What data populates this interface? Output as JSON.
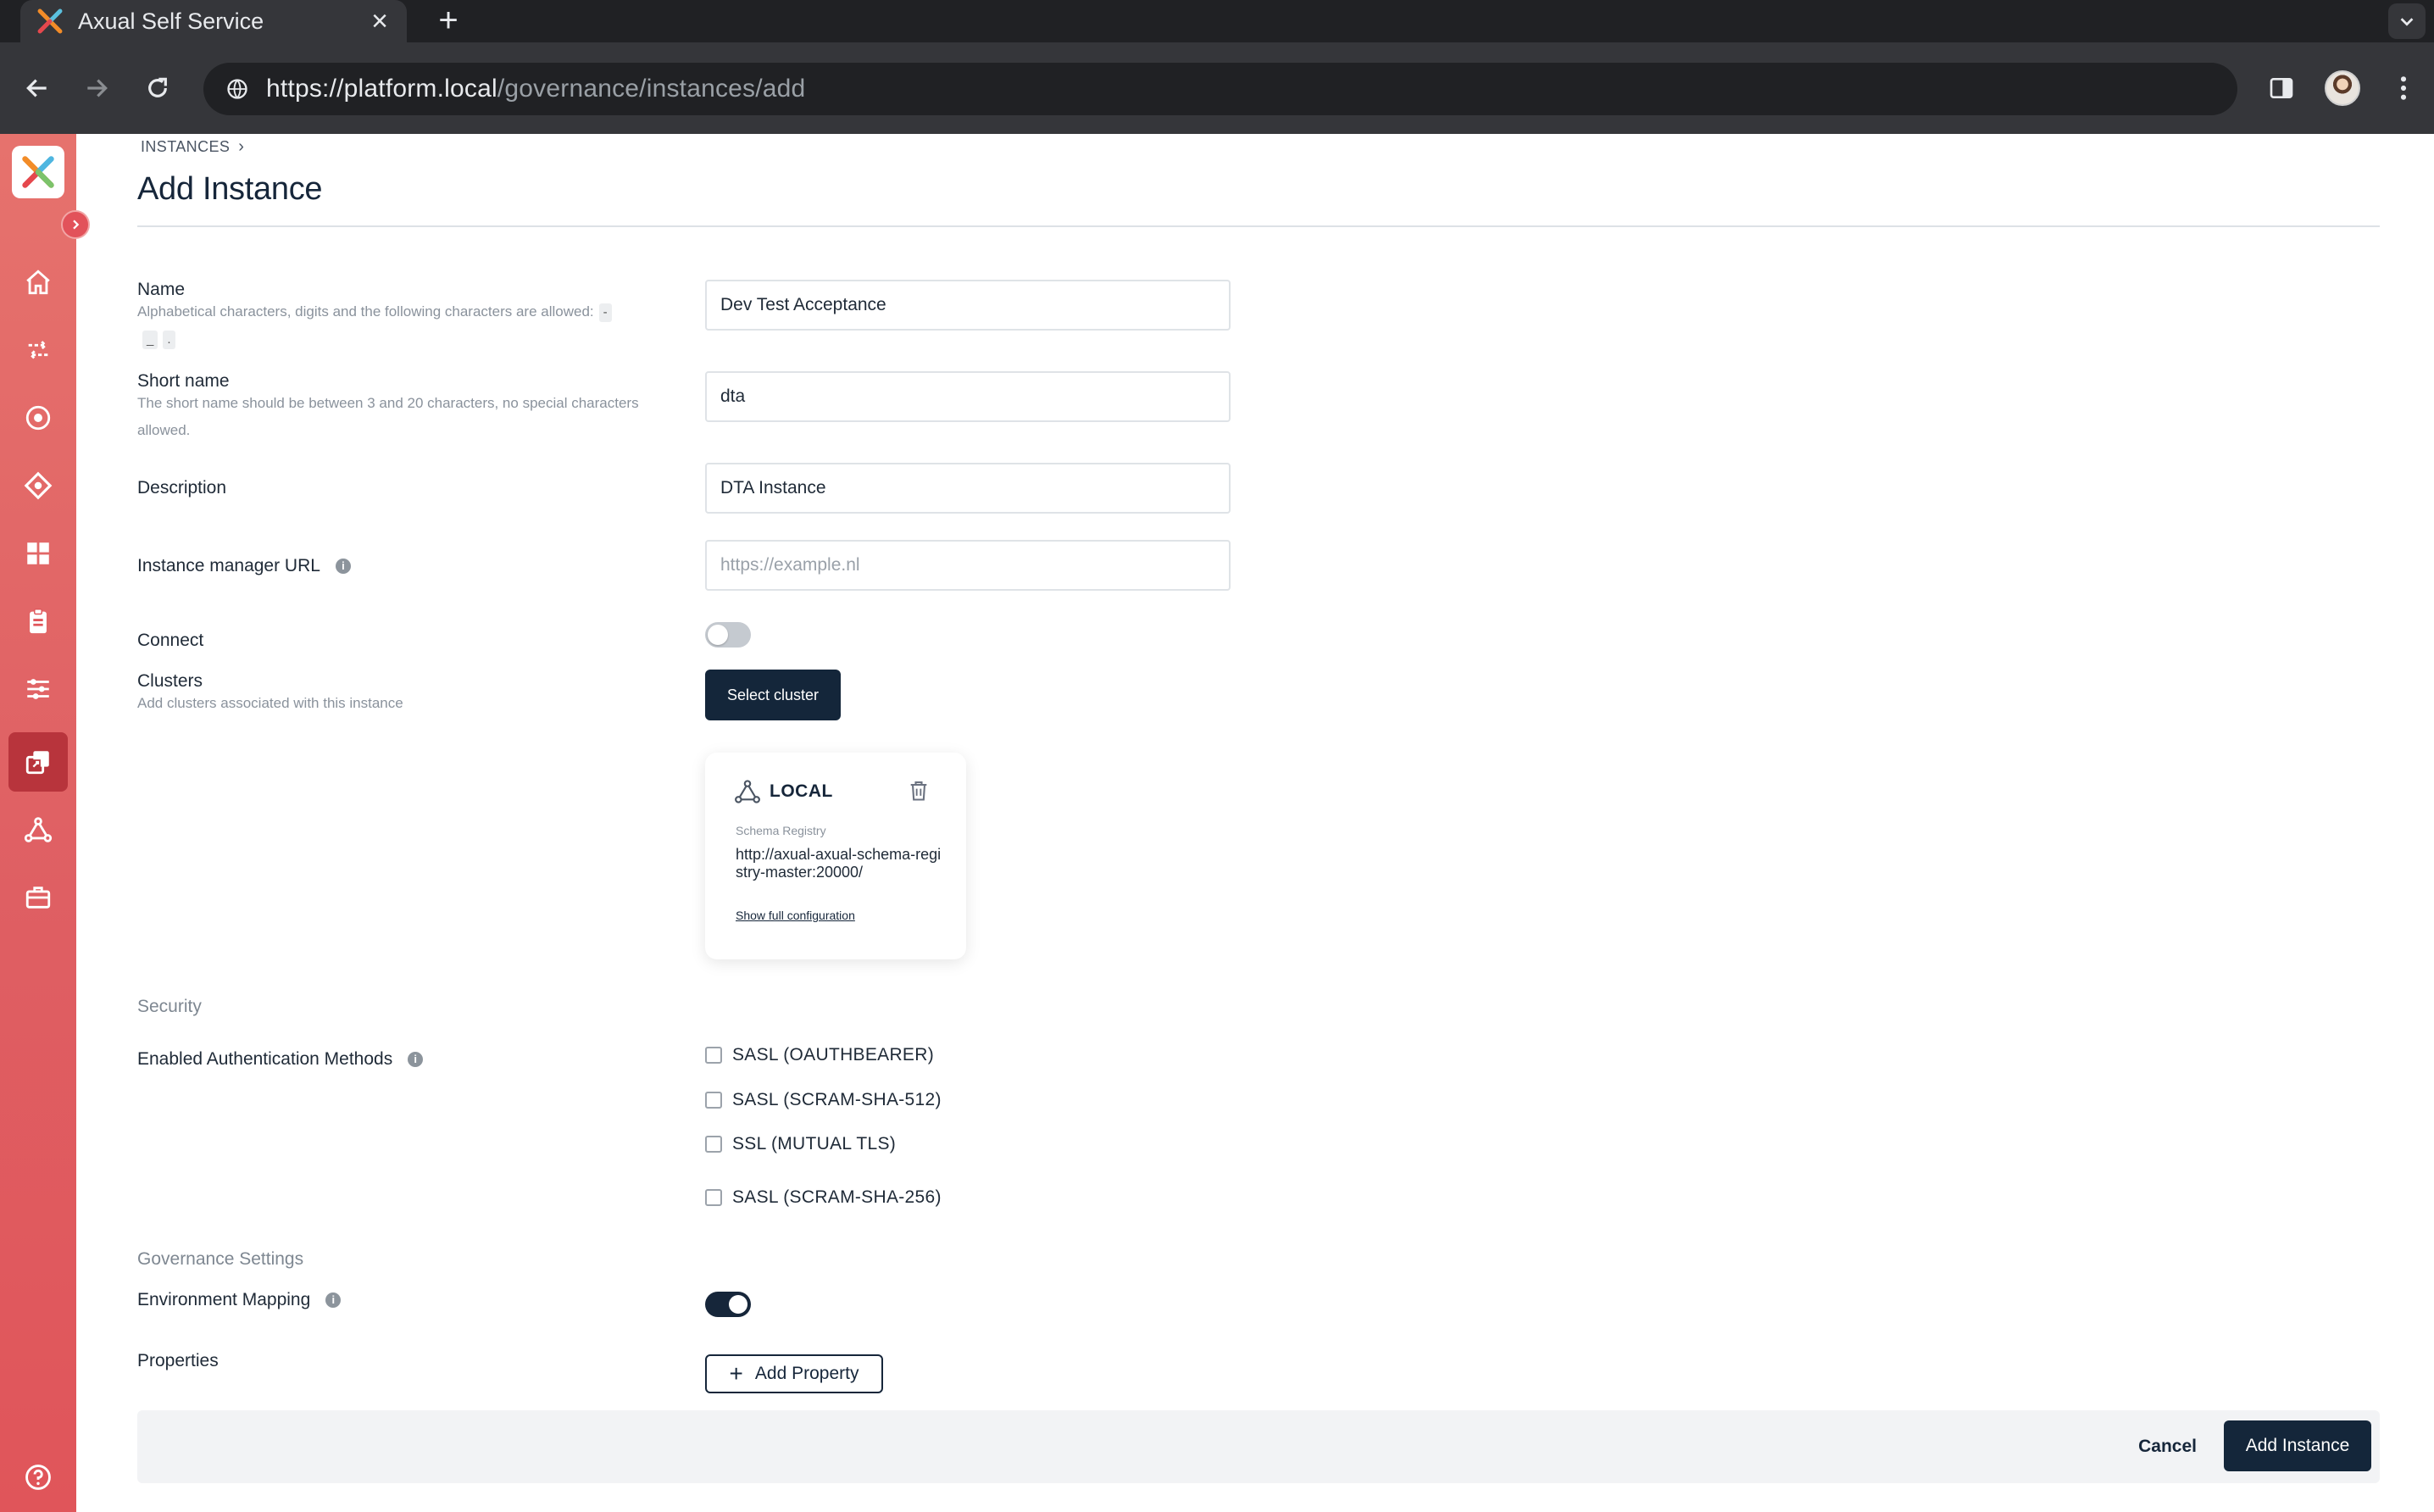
{
  "browser": {
    "tab_title": "Axual Self Service",
    "url_host": "https://platform.local",
    "url_path": "/governance/instances/add"
  },
  "breadcrumb": {
    "item": "INSTANCES"
  },
  "page": {
    "title": "Add Instance"
  },
  "form": {
    "name": {
      "label": "Name",
      "hint": "Alphabetical characters, digits and the following characters are allowed:",
      "allowed_chars": [
        "-",
        "_",
        "."
      ],
      "value": "Dev Test Acceptance"
    },
    "short_name": {
      "label": "Short name",
      "hint": "The short name should be between 3 and 20 characters, no special characters allowed.",
      "value": "dta"
    },
    "description": {
      "label": "Description",
      "value": "DTA Instance"
    },
    "instance_manager_url": {
      "label": "Instance manager URL",
      "placeholder": "https://example.nl",
      "value": ""
    },
    "connect": {
      "label": "Connect",
      "enabled": false
    },
    "clusters": {
      "label": "Clusters",
      "hint": "Add clusters associated with this instance",
      "select_button": "Select cluster",
      "items": [
        {
          "name": "LOCAL",
          "schema_registry_label": "Schema Registry",
          "schema_registry_url": "http://axual-axual-schema-registry-master:20000/",
          "link": "Show full configuration"
        }
      ]
    },
    "security": {
      "section": "Security",
      "auth_label": "Enabled Authentication Methods",
      "methods": [
        {
          "label": "SASL (OAUTHBEARER)",
          "checked": false
        },
        {
          "label": "SASL (SCRAM-SHA-512)",
          "checked": false
        },
        {
          "label": "SSL (MUTUAL TLS)",
          "checked": false
        },
        {
          "label": "SASL (SCRAM-SHA-256)",
          "checked": false
        }
      ]
    },
    "governance": {
      "section": "Governance Settings",
      "env_mapping_label": "Environment Mapping",
      "env_mapping_enabled": true
    },
    "properties": {
      "label": "Properties",
      "add_button": "Add Property"
    }
  },
  "footer": {
    "cancel": "Cancel",
    "submit": "Add Instance"
  },
  "colors": {
    "primary": "#14263a",
    "sidebar": "#e0555a",
    "sidebar_active": "#b8343c"
  }
}
